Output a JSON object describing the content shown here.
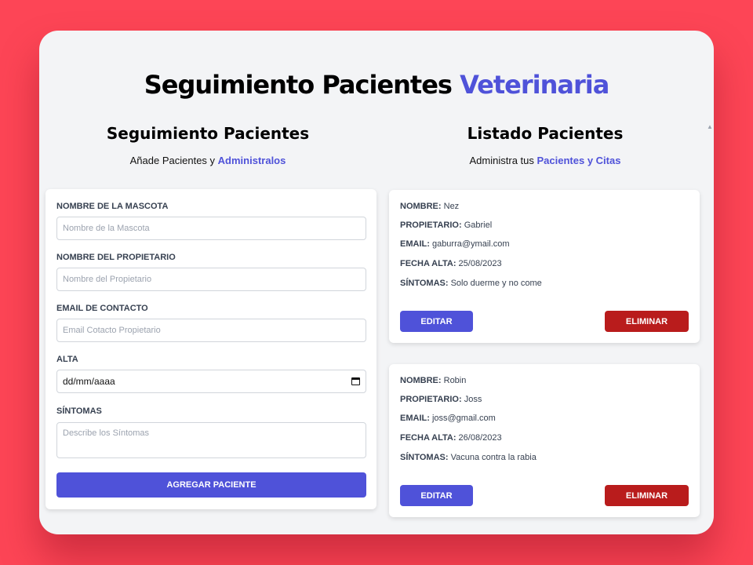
{
  "header": {
    "title_main": "Seguimiento Pacientes",
    "title_accent": "Veterinaria"
  },
  "form_section": {
    "title": "Seguimiento Pacientes",
    "subtitle_text": "Añade Pacientes y",
    "subtitle_accent": "Administralos",
    "fields": {
      "pet_name": {
        "label": "NOMBRE DE LA MASCOTA",
        "placeholder": "Nombre de la Mascota",
        "value": ""
      },
      "owner_name": {
        "label": "NOMBRE DEL PROPIETARIO",
        "placeholder": "Nombre del Propietario",
        "value": ""
      },
      "email": {
        "label": "EMAIL DE CONTACTO",
        "placeholder": "Email Cotacto Propietario",
        "value": ""
      },
      "date": {
        "label": "ALTA",
        "value": "dd/mm/aaaa"
      },
      "symptoms": {
        "label": "SÍNTOMAS",
        "placeholder": "Describe los Síntomas",
        "value": ""
      }
    },
    "submit_label": "AGREGAR PACIENTE"
  },
  "list_section": {
    "title": "Listado Pacientes",
    "subtitle_text": "Administra tus",
    "subtitle_accent": "Pacientes y Citas",
    "field_labels": {
      "name": "NOMBRE:",
      "owner": "PROPIETARIO:",
      "email": "EMAIL:",
      "date": "FECHA ALTA:",
      "symptoms": "SÍNTOMAS:"
    },
    "edit_label": "EDITAR",
    "delete_label": "ELIMINAR",
    "patients": [
      {
        "name": "Nez",
        "owner": "Gabriel",
        "email": "gaburra@ymail.com",
        "date": "25/08/2023",
        "symptoms": "Solo duerme y no come"
      },
      {
        "name": "Robin",
        "owner": "Joss",
        "email": "joss@gmail.com",
        "date": "26/08/2023",
        "symptoms": "Vacuna contra la rabia"
      }
    ]
  },
  "colors": {
    "background": "#fd4556",
    "accent": "#4f52d9",
    "danger": "#b91c1c",
    "panel": "#f3f4f6"
  }
}
